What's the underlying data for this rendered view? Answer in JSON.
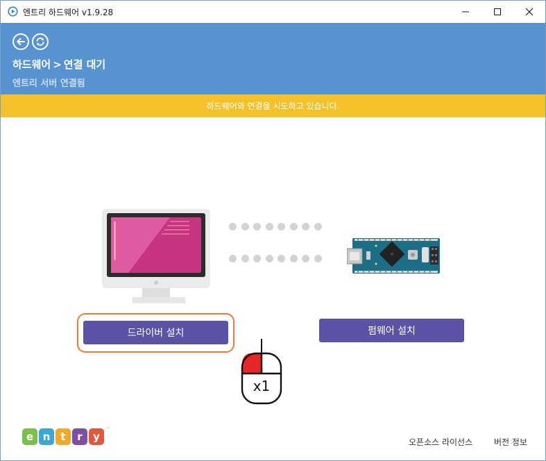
{
  "window": {
    "title": "엔트리 하드웨어 v1.9.28",
    "icon": "play-circle-icon"
  },
  "header": {
    "breadcrumb_hardware": "하드웨어",
    "breadcrumb_separator": ">",
    "breadcrumb_current": "연결 대기",
    "server_status": "엔트리 서버 연결됨",
    "back_icon": "arrow-left-icon",
    "refresh_icon": "refresh-icon"
  },
  "banner": {
    "message": "하드웨어와 연결을 시도하고 있습니다."
  },
  "illustration": {
    "computer_icon": "monitor-icon",
    "device_icon": "arduino-nano-board-icon"
  },
  "buttons": {
    "driver_label": "드라이버 설치",
    "firmware_label": "펌웨어 설치"
  },
  "hint": {
    "mouse_icon": "mouse-left-click-icon",
    "click_count": "x1"
  },
  "footer": {
    "logo_letters": [
      "e",
      "n",
      "t",
      "r",
      "y"
    ],
    "logo_trademark": "™",
    "license_label": "오픈소스 라이선스",
    "version_label": "버전 정보"
  },
  "colors": {
    "header_blue": "#5793d0",
    "banner_yellow": "#f4c12a",
    "button_purple": "#5b54a6",
    "highlight_orange": "#f07a35",
    "logo_tiles": [
      "#7bbf4d",
      "#3aa8d6",
      "#f0a82d",
      "#7d4fa0",
      "#e3573f"
    ]
  }
}
